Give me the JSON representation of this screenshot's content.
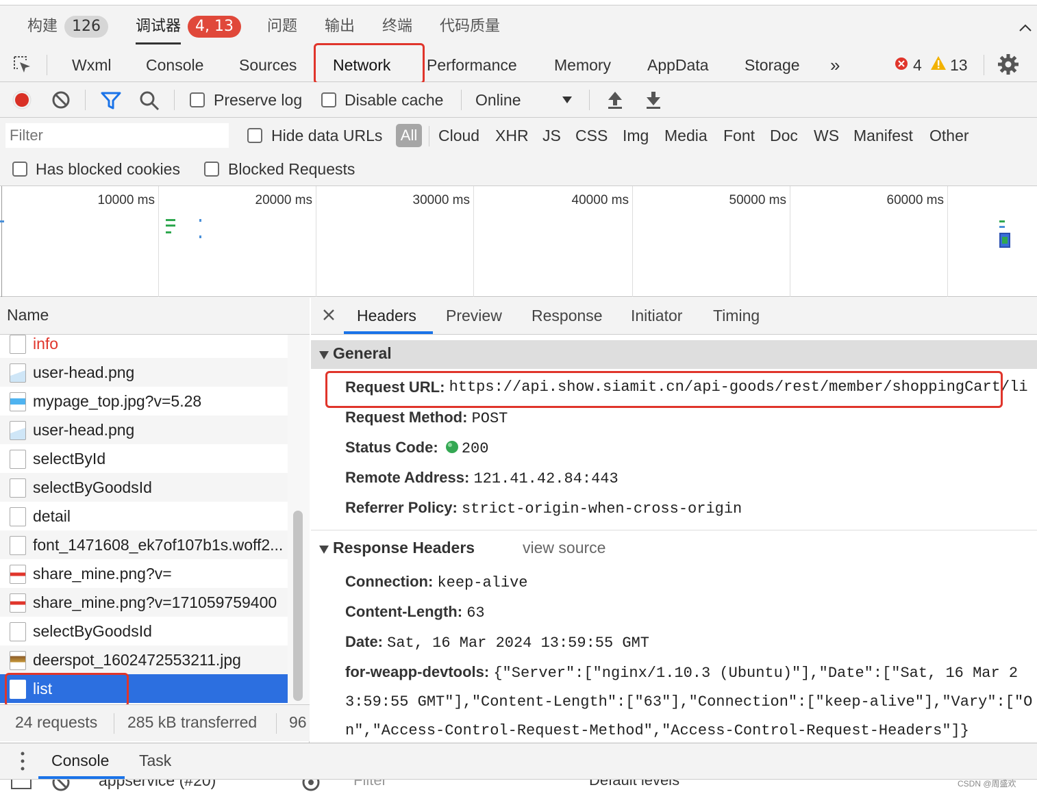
{
  "ide_tabs": [
    {
      "label": "构建",
      "badge": "126"
    },
    {
      "label": "调试器",
      "badge": "4, 13"
    },
    {
      "label": "问题"
    },
    {
      "label": "输出"
    },
    {
      "label": "终端"
    },
    {
      "label": "代码质量"
    }
  ],
  "devtools_tabs": [
    "Wxml",
    "Console",
    "Sources",
    "Network",
    "Performance",
    "Memory",
    "AppData",
    "Storage"
  ],
  "devtools_more": "»",
  "error_count": "4",
  "warning_count": "13",
  "toolbar": {
    "preserve_log": "Preserve log",
    "disable_cache": "Disable cache",
    "throttling": "Online"
  },
  "filter": {
    "placeholder": "Filter",
    "hide_data_urls": "Hide data URLs",
    "types": [
      "All",
      "Cloud",
      "XHR",
      "JS",
      "CSS",
      "Img",
      "Media",
      "Font",
      "Doc",
      "WS",
      "Manifest",
      "Other"
    ],
    "has_blocked_cookies": "Has blocked cookies",
    "blocked_requests": "Blocked Requests"
  },
  "timeline": {
    "labels": [
      "10000 ms",
      "20000 ms",
      "30000 ms",
      "40000 ms",
      "50000 ms",
      "60000 ms"
    ]
  },
  "requests": {
    "header": "Name",
    "items": [
      {
        "name": "info",
        "type": "doc",
        "color": "#e0352b"
      },
      {
        "name": "user-head.png",
        "type": "img"
      },
      {
        "name": "mypage_top.jpg?v=5.28",
        "type": "img-blue"
      },
      {
        "name": "user-head.png",
        "type": "img"
      },
      {
        "name": "selectById",
        "type": "doc"
      },
      {
        "name": "selectByGoodsId",
        "type": "doc"
      },
      {
        "name": "detail",
        "type": "doc"
      },
      {
        "name": "font_1471608_ek7of107b1s.woff2...",
        "type": "doc"
      },
      {
        "name": "share_mine.png?v=",
        "type": "img-red"
      },
      {
        "name": "share_mine.png?v=171059759400",
        "type": "img-red"
      },
      {
        "name": "selectByGoodsId",
        "type": "doc"
      },
      {
        "name": "deerspot_1602472553211.jpg",
        "type": "img-photo"
      },
      {
        "name": "list",
        "type": "doc",
        "selected": true
      }
    ],
    "summary": [
      "24 requests",
      "285 kB transferred",
      "96"
    ]
  },
  "detail": {
    "tabs": [
      "Headers",
      "Preview",
      "Response",
      "Initiator",
      "Timing"
    ],
    "general": {
      "title": "General",
      "rows": [
        {
          "key": "Request URL:",
          "value": "https://api.show.siamit.cn/api-goods/rest/member/shoppingCart/li"
        },
        {
          "key": "Request Method:",
          "value": "POST"
        },
        {
          "key": "Status Code:",
          "value": "200"
        },
        {
          "key": "Remote Address:",
          "value": "121.41.42.84:443"
        },
        {
          "key": "Referrer Policy:",
          "value": "strict-origin-when-cross-origin"
        }
      ]
    },
    "response_headers": {
      "title": "Response Headers",
      "view_source": "view source",
      "rows": [
        {
          "key": "Connection:",
          "value": "keep-alive"
        },
        {
          "key": "Content-Length:",
          "value": "63"
        },
        {
          "key": "Date:",
          "value": "Sat, 16 Mar 2024 13:59:55 GMT"
        },
        {
          "key": "for-weapp-devtools:",
          "value": "{\"Server\":[\"nginx/1.10.3 (Ubuntu)\"],\"Date\":[\"Sat, 16 Mar 2"
        }
      ],
      "wrap_lines": [
        "3:59:55 GMT\"],\"Content-Length\":[\"63\"],\"Connection\":[\"keep-alive\"],\"Vary\":[\"O",
        "n\",\"Access-Control-Request-Method\",\"Access-Control-Request-Headers\"]}"
      ]
    }
  },
  "drawer": {
    "tabs": [
      "Console",
      "Task"
    ],
    "context": "appservice (#20)",
    "filter": "Filter",
    "levels": "Default levels"
  },
  "watermark": "CSDN @周盛欢"
}
